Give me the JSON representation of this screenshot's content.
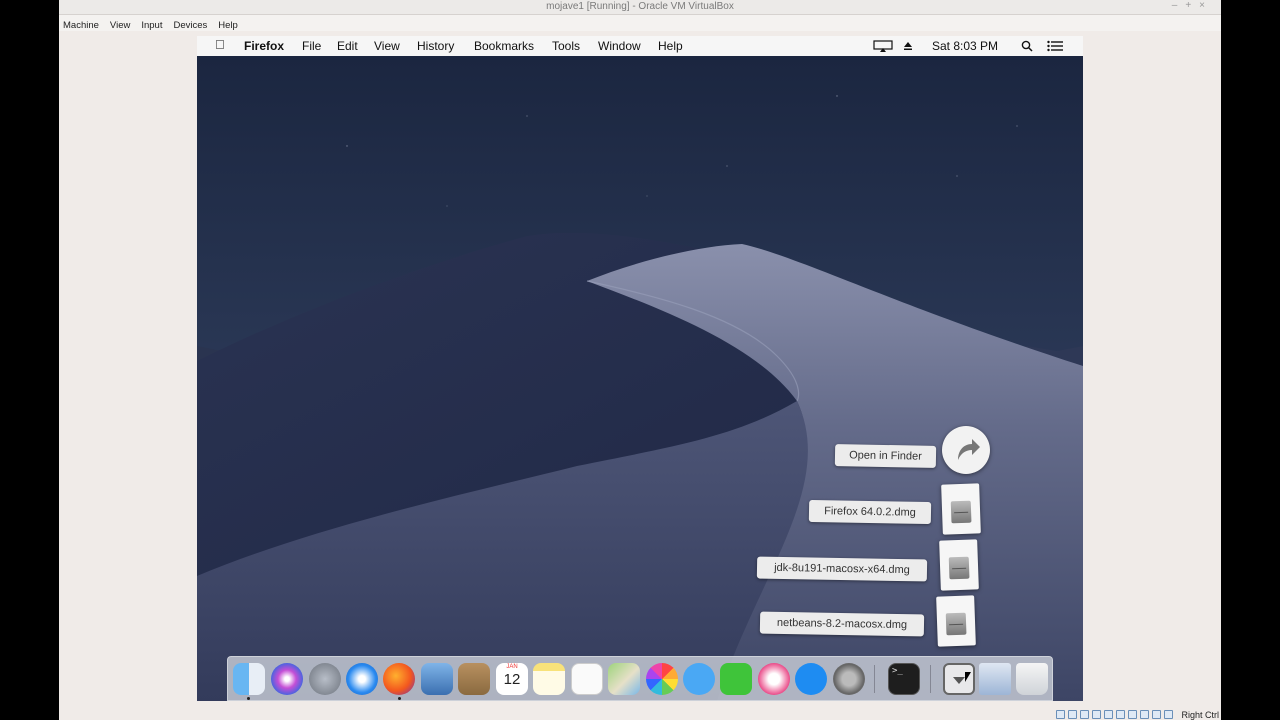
{
  "vbox": {
    "title": "mojave1 [Running] - Oracle VM VirtualBox",
    "menu": [
      "Machine",
      "View",
      "Input",
      "Devices",
      "Help"
    ],
    "host_key": "Right Ctrl"
  },
  "mac_menu": {
    "app": "Firefox",
    "items": [
      "File",
      "Edit",
      "View",
      "History",
      "Bookmarks",
      "Tools",
      "Window",
      "Help"
    ],
    "clock": "Sat 8:03 PM"
  },
  "stack": {
    "open_in_finder": "Open in Finder",
    "files": [
      "Firefox 64.0.2.dmg",
      "jdk-8u191-macosx-x64.dmg",
      "netbeans-8.2-macosx.dmg"
    ]
  },
  "dock": {
    "calendar_month": "JAN",
    "calendar_day": "12",
    "icons": [
      "finder-icon",
      "siri-icon",
      "launchpad-icon",
      "safari-icon",
      "firefox-icon",
      "preview-icon",
      "contacts-icon",
      "calendar-icon",
      "notes-icon",
      "reminders-icon",
      "maps-icon",
      "photos-icon",
      "messages-icon",
      "facetime-icon",
      "itunes-icon",
      "app-store-icon",
      "system-preferences-icon",
      "terminal-icon",
      "downloads-stack-icon",
      "web-document-icon",
      "trash-icon"
    ]
  },
  "colors": {
    "sky": "#1f2a45",
    "dune": "#5c6584",
    "menubar": "#f6f6f6",
    "host_bg": "#f0ebe8"
  }
}
